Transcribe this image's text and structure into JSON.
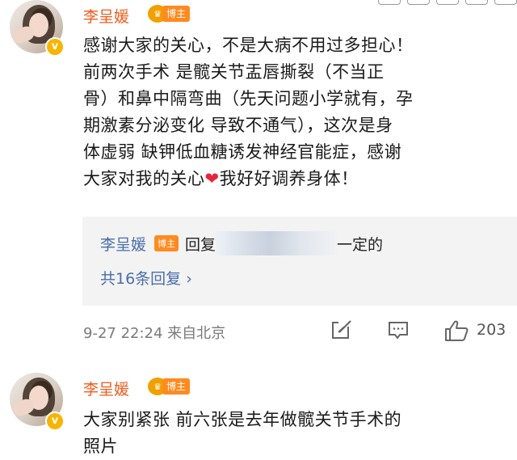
{
  "post1": {
    "username": "李呈媛",
    "tag_label": "博主",
    "content_lines": [
      "感谢大家的关心，不是大病不用过多担心！",
      "前两次手术 是髋关节盂唇撕裂（不当正",
      "骨）和鼻中隔弯曲（先天问题小学就有，孕",
      "期激素分泌变化 导致不通气），这次是身",
      "体虚弱 缺钾低血糖诱发神经官能症，感谢",
      "大家对我的关心"
    ],
    "content_heart": "❤",
    "content_tail": "我好好调养身体！",
    "reply": {
      "author": "李呈媛",
      "tag_label": "博主",
      "prefix": "回复",
      "suffix": "一定的",
      "count_text": "共16条回复 ›"
    },
    "meta": "9-27 22:24 来自北京",
    "like_count": "203"
  },
  "post2": {
    "username": "李呈媛",
    "tag_label": "博主",
    "content_lines": [
      "大家别紧张 前六张是去年做髋关节手术的",
      "照片"
    ]
  },
  "icons": {
    "verified": "v",
    "share": "share-icon",
    "comment": "comment-icon",
    "like": "thumbs-up-icon"
  }
}
